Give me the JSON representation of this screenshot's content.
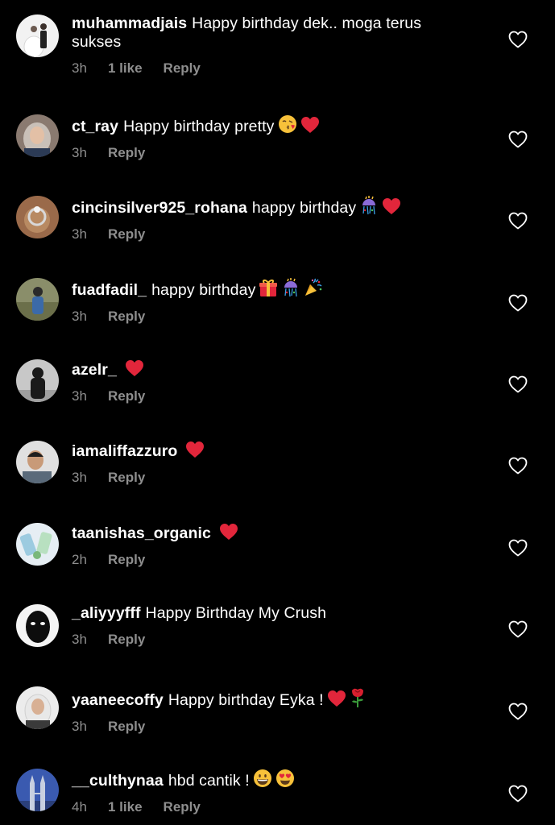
{
  "colors": {
    "background": "#000000",
    "text": "#ffffff",
    "meta": "#8e8e8e",
    "heart_emoji": "#e2263b"
  },
  "comments": [
    {
      "username": "muhammadjais",
      "text": "Happy birthday dek.. moga terus sukses",
      "emojis": [],
      "time": "3h",
      "likes": "1 like",
      "reply": "Reply",
      "avatar_icon": "wedding-couple-photo"
    },
    {
      "username": "ct_ray",
      "text": "Happy birthday pretty",
      "emojis": [
        "kissing-face-icon",
        "red-heart-icon"
      ],
      "time": "3h",
      "likes": "",
      "reply": "Reply",
      "avatar_icon": "hijab-woman-photo"
    },
    {
      "username": "cincinsilver925_rohana",
      "text": "happy birthday",
      "emojis": [
        "confetti-ball-icon",
        "red-heart-icon"
      ],
      "time": "3h",
      "likes": "",
      "reply": "Reply",
      "avatar_icon": "silver-ring-photo"
    },
    {
      "username": "fuadfadil_",
      "text": "happy birthday",
      "emojis": [
        "gift-icon",
        "confetti-ball-icon",
        "party-popper-icon"
      ],
      "time": "3h",
      "likes": "",
      "reply": "Reply",
      "avatar_icon": "man-outdoor-photo"
    },
    {
      "username": "azelr_",
      "text": "",
      "emojis": [
        "red-heart-icon"
      ],
      "time": "3h",
      "likes": "",
      "reply": "Reply",
      "avatar_icon": "dark-figure-photo"
    },
    {
      "username": "iamaliffazzuro",
      "text": "",
      "emojis": [
        "red-heart-icon"
      ],
      "time": "3h",
      "likes": "",
      "reply": "Reply",
      "avatar_icon": "man-selfie-photo"
    },
    {
      "username": "taanishas_organic",
      "text": "",
      "emojis": [
        "red-heart-icon"
      ],
      "time": "2h",
      "likes": "",
      "reply": "Reply",
      "avatar_icon": "organic-products-photo"
    },
    {
      "username": "_aliyyyfff",
      "text": "Happy Birthday My Crush",
      "emojis": [],
      "time": "3h",
      "likes": "",
      "reply": "Reply",
      "avatar_icon": "mask-photo"
    },
    {
      "username": "yaaneecoffy",
      "text": "Happy birthday Eyka !",
      "emojis": [
        "red-heart-icon",
        "rose-icon"
      ],
      "time": "3h",
      "likes": "",
      "reply": "Reply",
      "avatar_icon": "hijab-woman-photo"
    },
    {
      "username": "__culthynaa",
      "text": "hbd cantik !",
      "emojis": [
        "grinning-face-icon",
        "heart-eyes-face-icon"
      ],
      "time": "4h",
      "likes": "1 like",
      "reply": "Reply",
      "avatar_icon": "twin-towers-photo"
    }
  ],
  "like_button_icon": "heart-outline-icon"
}
